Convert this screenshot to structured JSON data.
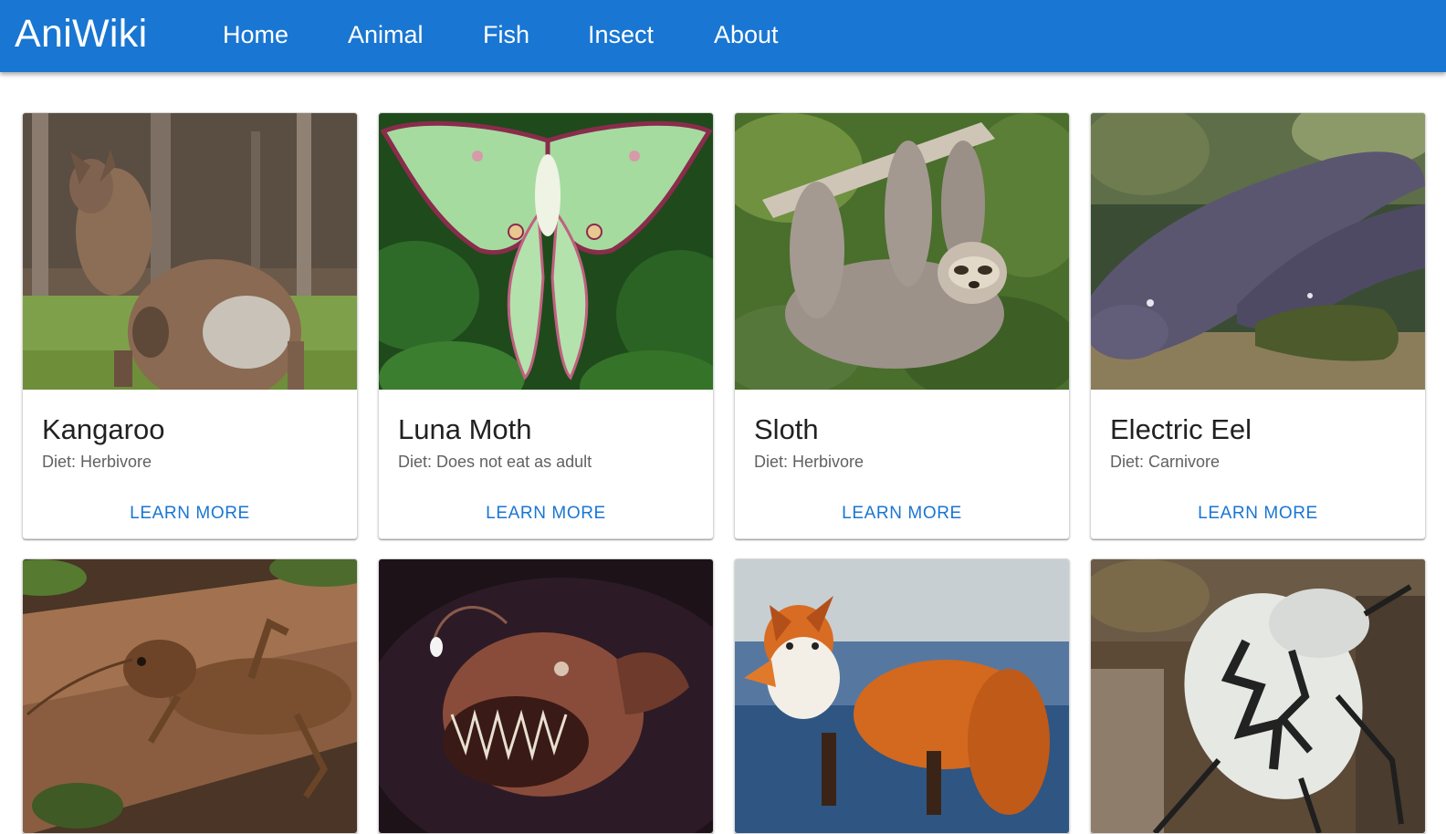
{
  "app": {
    "brand": "AniWiki",
    "accent_color": "#1976d2"
  },
  "nav": {
    "items": [
      {
        "label": "Home"
      },
      {
        "label": "Animal"
      },
      {
        "label": "Fish"
      },
      {
        "label": "Insect"
      },
      {
        "label": "About"
      }
    ]
  },
  "cards": [
    {
      "title": "Kangaroo",
      "diet": "Diet: Herbivore",
      "button": "LEARN MORE",
      "image": "kangaroo-photo"
    },
    {
      "title": "Luna Moth",
      "diet": "Diet: Does not eat as adult",
      "button": "LEARN MORE",
      "image": "luna-moth-photo"
    },
    {
      "title": "Sloth",
      "diet": "Diet: Herbivore",
      "button": "LEARN MORE",
      "image": "sloth-photo"
    },
    {
      "title": "Electric Eel",
      "diet": "Diet: Carnivore",
      "button": "LEARN MORE",
      "image": "electric-eel-photo"
    },
    {
      "image": "weta-insect-photo"
    },
    {
      "image": "anglerfish-photo"
    },
    {
      "image": "red-fox-photo"
    },
    {
      "image": "goliath-beetle-photo"
    }
  ]
}
